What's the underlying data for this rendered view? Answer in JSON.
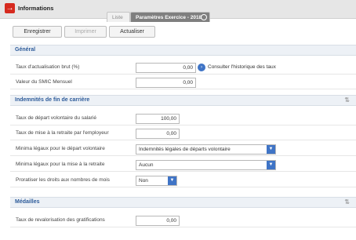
{
  "window": {
    "logo_glyph": "→",
    "title": "Informations"
  },
  "tabs": [
    {
      "label": "Liste"
    },
    {
      "label": "Paramètres Exercice - 2018"
    }
  ],
  "toolbar": {
    "save_label": "Enregistrer",
    "print_label": "Imprimer",
    "refresh_label": "Actualiser"
  },
  "sections": {
    "general": {
      "title": "Général",
      "rows": [
        {
          "label": "Taux d'actualisation brut (%)",
          "value": "0,00",
          "link": "Consulter l'historique des taux"
        },
        {
          "label": "Valeur du SMIC Mensuel",
          "value": "0,00"
        }
      ]
    },
    "indemnites": {
      "title": "Indemnités de fin de carrière",
      "rows": [
        {
          "label": "Taux de départ volontaire du salarié",
          "value": "100,00"
        },
        {
          "label": "Taux de mise à la retraite par l'employeur",
          "value": "0,00"
        },
        {
          "label": "Minima légaux pour le départ volontaire",
          "selected": "Indemnités légales de départs volontaire"
        },
        {
          "label": "Minima légaux pour la mise à la retraite",
          "selected": "Aucun"
        },
        {
          "label": "Proratiser les droits aux nombres de mois",
          "selected": "Non"
        }
      ]
    },
    "medailles": {
      "title": "Médailles",
      "rows": [
        {
          "label": "Taux de revalorisation des gratifications",
          "value": "0,00"
        }
      ]
    }
  },
  "colors": {
    "accent": "#2d5b9a",
    "brand_red": "#d62a1f",
    "select_arrow": "#3f74c6"
  }
}
